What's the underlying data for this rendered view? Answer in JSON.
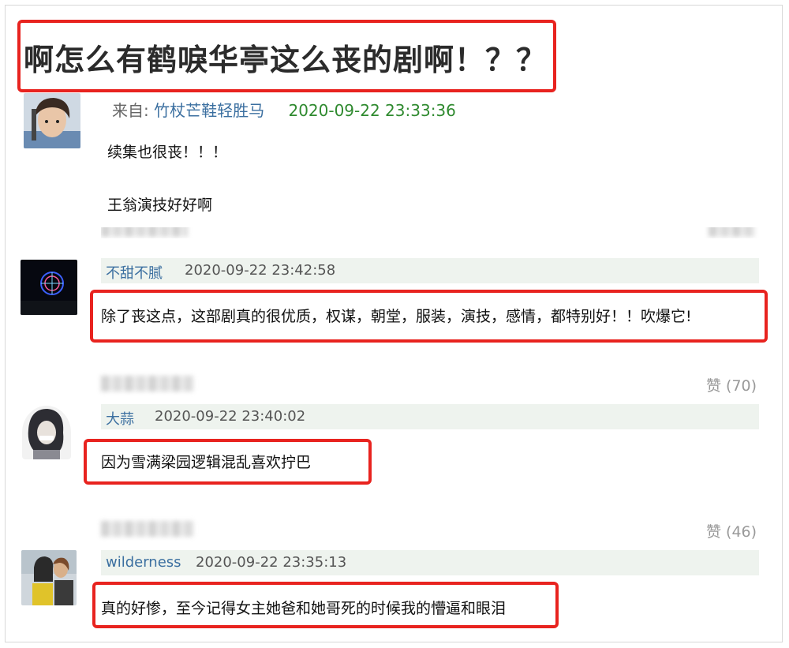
{
  "post": {
    "title": "啊怎么有鹤唳华亭这么丧的剧啊！？？",
    "from_label": "来自:",
    "author": "竹杖芒鞋轻胜马",
    "timestamp": "2020-09-22 23:33:36",
    "lines": [
      "续集也很丧！！！",
      "王翁演技好好啊"
    ]
  },
  "replies": [
    {
      "author": "不甜不腻",
      "timestamp": "2020-09-22 23:42:58",
      "text": "除了丧这点，这部剧真的很优质，权谋，朝堂，服装，演技，感情，都特别好！！吹爆它!",
      "likes": "赞 (70)"
    },
    {
      "author": "大蒜",
      "timestamp": "2020-09-22 23:40:02",
      "text": "因为雪满梁园逻辑混乱喜欢拧巴",
      "likes": "赞 (46)"
    },
    {
      "author": "wilderness",
      "timestamp": "2020-09-22 23:35:13",
      "text": "真的好惨，至今记得女主她爸和她哥死的时候我的懵逼和眼泪"
    }
  ],
  "colors": {
    "highlight": "#e8231f",
    "link": "#3b6fa0",
    "timestamp_green": "#2f8a2f",
    "reply_bar": "#eef3ee"
  }
}
